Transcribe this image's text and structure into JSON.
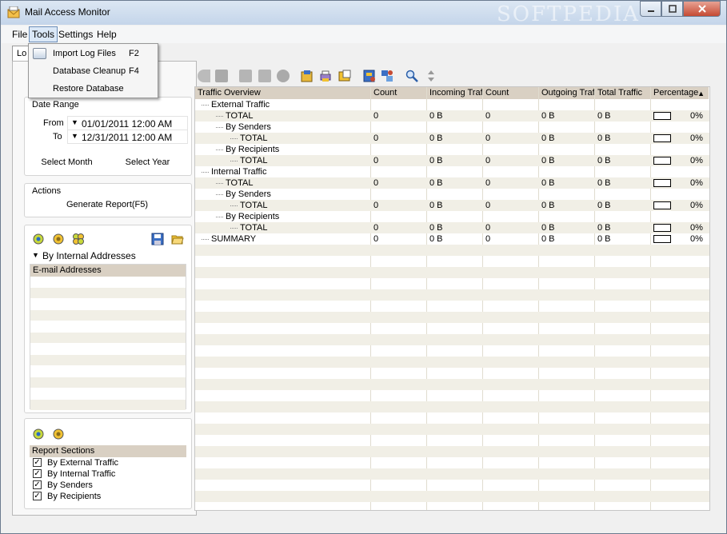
{
  "window": {
    "title": "Mail Access Monitor",
    "min": "0",
    "max": "1",
    "close": "r",
    "watermark": "SOFTPEDIA"
  },
  "menu": {
    "file": "File",
    "tools": "Tools",
    "settings": "Settings",
    "help": "Help"
  },
  "tools_menu": [
    {
      "label": "Import Log Files",
      "key": "F2"
    },
    {
      "label": "Database Cleanup",
      "key": "F4"
    },
    {
      "label": "Restore Database",
      "key": ""
    }
  ],
  "tab": {
    "label": "Lo"
  },
  "date_range": {
    "title": "Date Range",
    "from_label": "From",
    "from_value": "01/01/2011 12:00 AM",
    "to_label": "To",
    "to_value": "12/31/2011 12:00 AM",
    "select_month": "Select Month",
    "select_year": "Select Year"
  },
  "actions": {
    "title": "Actions",
    "generate": "Generate Report(F5)"
  },
  "addresses": {
    "group_by": "By Internal Addresses",
    "header": "E-mail Addresses"
  },
  "report_sections": {
    "header": "Report Sections",
    "items": [
      {
        "label": "By External Traffic",
        "checked": "✓"
      },
      {
        "label": "By Internal Traffic",
        "checked": "✓"
      },
      {
        "label": "By Senders",
        "checked": "✓"
      },
      {
        "label": "By Recipients",
        "checked": "✓"
      }
    ]
  },
  "grid": {
    "columns": [
      "Traffic Overview",
      "Count",
      "Incoming Traffic",
      "Count",
      "Outgoing Traffic",
      "Total Traffic",
      "Percentage"
    ],
    "sort_indicator": "▲",
    "rows": [
      {
        "name": "External Traffic",
        "count": "",
        "in": "",
        "count2": "",
        "out": "",
        "total": "",
        "pct": ""
      },
      {
        "name": "TOTAL",
        "count": "0",
        "in": "0 B",
        "count2": "0",
        "out": "0 B",
        "total": "0 B",
        "pct": "0%"
      },
      {
        "name": "By Senders",
        "count": "",
        "in": "",
        "count2": "",
        "out": "",
        "total": "",
        "pct": ""
      },
      {
        "name": "TOTAL",
        "count": "0",
        "in": "0 B",
        "count2": "0",
        "out": "0 B",
        "total": "0 B",
        "pct": "0%"
      },
      {
        "name": "By Recipients",
        "count": "",
        "in": "",
        "count2": "",
        "out": "",
        "total": "",
        "pct": ""
      },
      {
        "name": "TOTAL",
        "count": "0",
        "in": "0 B",
        "count2": "0",
        "out": "0 B",
        "total": "0 B",
        "pct": "0%"
      },
      {
        "name": "Internal Traffic",
        "count": "",
        "in": "",
        "count2": "",
        "out": "",
        "total": "",
        "pct": ""
      },
      {
        "name": "TOTAL",
        "count": "0",
        "in": "0 B",
        "count2": "0",
        "out": "0 B",
        "total": "0 B",
        "pct": "0%"
      },
      {
        "name": "By Senders",
        "count": "",
        "in": "",
        "count2": "",
        "out": "",
        "total": "",
        "pct": ""
      },
      {
        "name": "TOTAL",
        "count": "0",
        "in": "0 B",
        "count2": "0",
        "out": "0 B",
        "total": "0 B",
        "pct": "0%"
      },
      {
        "name": "By Recipients",
        "count": "",
        "in": "",
        "count2": "",
        "out": "",
        "total": "",
        "pct": ""
      },
      {
        "name": "TOTAL",
        "count": "0",
        "in": "0 B",
        "count2": "0",
        "out": "0 B",
        "total": "0 B",
        "pct": "0%"
      },
      {
        "name": "SUMMARY",
        "count": "0",
        "in": "0 B",
        "count2": "0",
        "out": "0 B",
        "total": "0 B",
        "pct": "0%"
      }
    ]
  },
  "colors": {
    "header_bg": "#d9d0c3",
    "stripe": "#f1efe6",
    "accent": "#c54a33"
  }
}
